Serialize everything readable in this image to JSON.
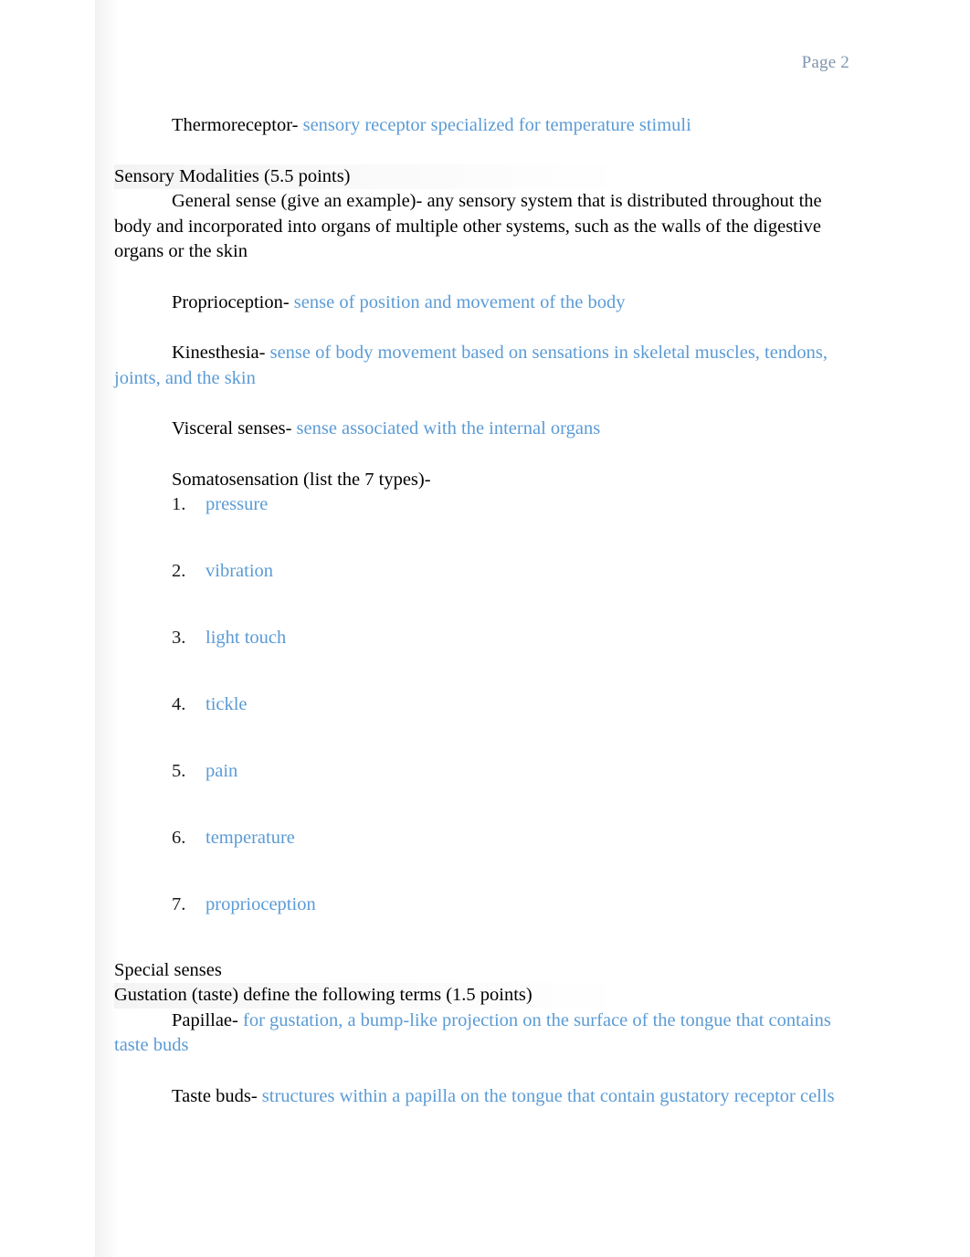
{
  "page": {
    "header_label": "Page 2"
  },
  "entries": {
    "thermoreceptor": {
      "term": "Thermoreceptor-",
      "definition": " sensory receptor specialized for temperature stimuli"
    },
    "general_sense": {
      "text": "General sense (give an example)- any sensory system that is distributed throughout the body and incorporated into organs of multiple other systems, such as the walls of the digestive organs or the skin"
    },
    "proprioception": {
      "term": "Proprioception-",
      "definition": " sense of position and movement of the body"
    },
    "kinesthesia": {
      "term": "Kinesthesia-",
      "definition": " sense of body movement based on sensations in skeletal muscles, tendons, joints, and the skin"
    },
    "visceral_senses": {
      "term": "Visceral senses-",
      "definition": " sense associated with the internal organs"
    },
    "papillae": {
      "term": "Papillae-",
      "definition": " for gustation, a bump-like projection on the surface of the tongue that contains taste buds"
    },
    "taste_buds": {
      "term": "Taste buds-",
      "definition": " structures within a papilla on the tongue that contain gustatory receptor cells"
    }
  },
  "headings": {
    "sensory_modalities": "Sensory Modalities (5.5 points)",
    "somatosensation": "Somatosensation (list the 7 types)-",
    "special_senses": "Special senses",
    "gustation": "Gustation (taste) define the following terms (1.5 points)"
  },
  "somatosensation_list": [
    {
      "number": "1.",
      "label": "pressure"
    },
    {
      "number": "2.",
      "label": "vibration"
    },
    {
      "number": "3.",
      "label": "light touch"
    },
    {
      "number": "4.",
      "label": "tickle"
    },
    {
      "number": "5.",
      "label": "pain"
    },
    {
      "number": "6.",
      "label": "temperature"
    },
    {
      "number": "7.",
      "label": "proprioception"
    }
  ],
  "colors": {
    "answer_blue": "#5b9bd5",
    "term_black": "#000000",
    "header_gray": "#8096b0",
    "page_background": "#ffffff"
  }
}
